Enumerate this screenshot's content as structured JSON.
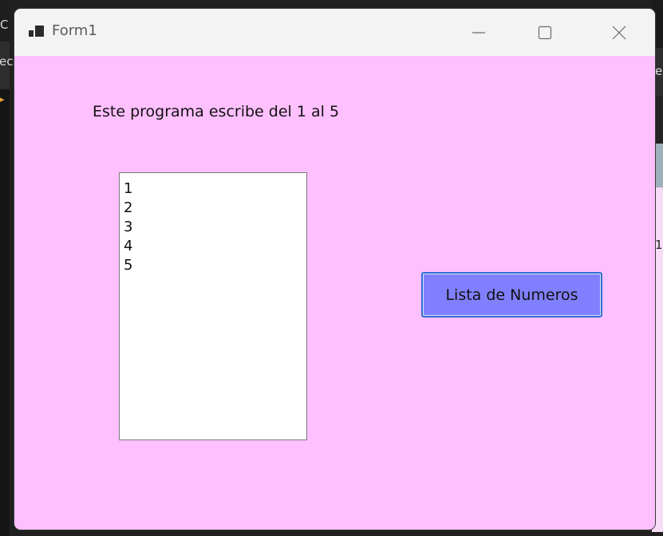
{
  "window": {
    "title": "Form1"
  },
  "form": {
    "label_text": "Este programa escribe del 1 al 5",
    "listbox_items": [
      "1",
      "2",
      "3",
      "4",
      "5"
    ],
    "button_label": "Lista de Numeros"
  },
  "background": {
    "left_glyphs": [
      "C",
      "ec"
    ],
    "right_glyphs": [
      "e",
      "1"
    ]
  },
  "colors": {
    "form_background": "#ffc0ff",
    "button_background": "#8080ff",
    "button_border": "#2f6fcf",
    "titlebar_background": "#f3f3f3"
  }
}
